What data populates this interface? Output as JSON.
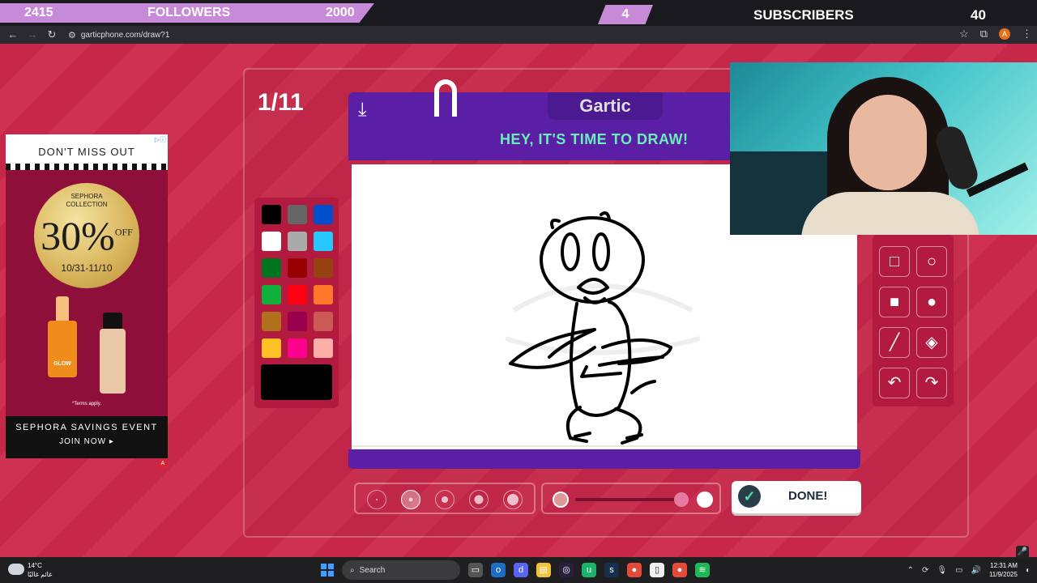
{
  "overlay": {
    "followers_count": "2415",
    "followers_label": "FOLLOWERS",
    "followers_goal": "2000",
    "subscribers_count": "4",
    "subscribers_label": "SUBSCRIBERS",
    "subscribers_goal": "40"
  },
  "browser": {
    "url": "garticphone.com/draw?1",
    "profile_initial": "A"
  },
  "ad": {
    "top_label": "DON'T MISS OUT",
    "seal_line1": "SEPHORA",
    "seal_line2": "COLLECTION",
    "percent": "30%",
    "off": "OFF",
    "dates": "10/31-11/10",
    "bottle_label": "GLOW",
    "terms": "*Terms apply.",
    "event": "SEPHORA SAVINGS EVENT",
    "cta": "JOIN NOW ▸"
  },
  "game": {
    "round": "1/11",
    "logo": "Gartic",
    "title": "HEY, IT'S TIME TO DRAW!",
    "done_label": "DONE!",
    "palette": [
      "#000000",
      "#666666",
      "#0050cd",
      "#ffffff",
      "#aaaaaa",
      "#26c9ff",
      "#017420",
      "#990000",
      "#964112",
      "#11b03c",
      "#ff0013",
      "#ff7829",
      "#b0701c",
      "#99004e",
      "#cb5a57",
      "#ffc126",
      "#ff008f",
      "#feafa8"
    ],
    "current_color": "#000000",
    "tools": [
      "pen-icon",
      "eraser-icon",
      "square-outline-icon",
      "circle-outline-icon",
      "square-filled-icon",
      "circle-filled-icon",
      "line-icon",
      "fill-bucket-icon",
      "undo-icon",
      "redo-icon"
    ],
    "brush_sizes": 5,
    "selected_brush": 2
  },
  "taskbar": {
    "temperature": "14°C",
    "condition": "غائم غالبًا",
    "search_placeholder": "Search",
    "time": "12:31 AM",
    "date": "11/9/2025"
  }
}
